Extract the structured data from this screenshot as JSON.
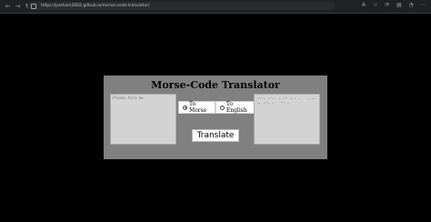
{
  "browser": {
    "url": "https://parham2002.github.io/morse-code-translator/"
  },
  "app": {
    "title": "Morse-Code Translator",
    "input": {
      "placeholder": "Please hire me"
    },
    "output": {
      "value": ".--. .-.. . .- ... .   .... .. .-. .   -- ."
    },
    "options": [
      {
        "label": "To Morse",
        "checked": true
      },
      {
        "label": "To English",
        "checked": false
      }
    ],
    "translate_label": "Translate"
  }
}
